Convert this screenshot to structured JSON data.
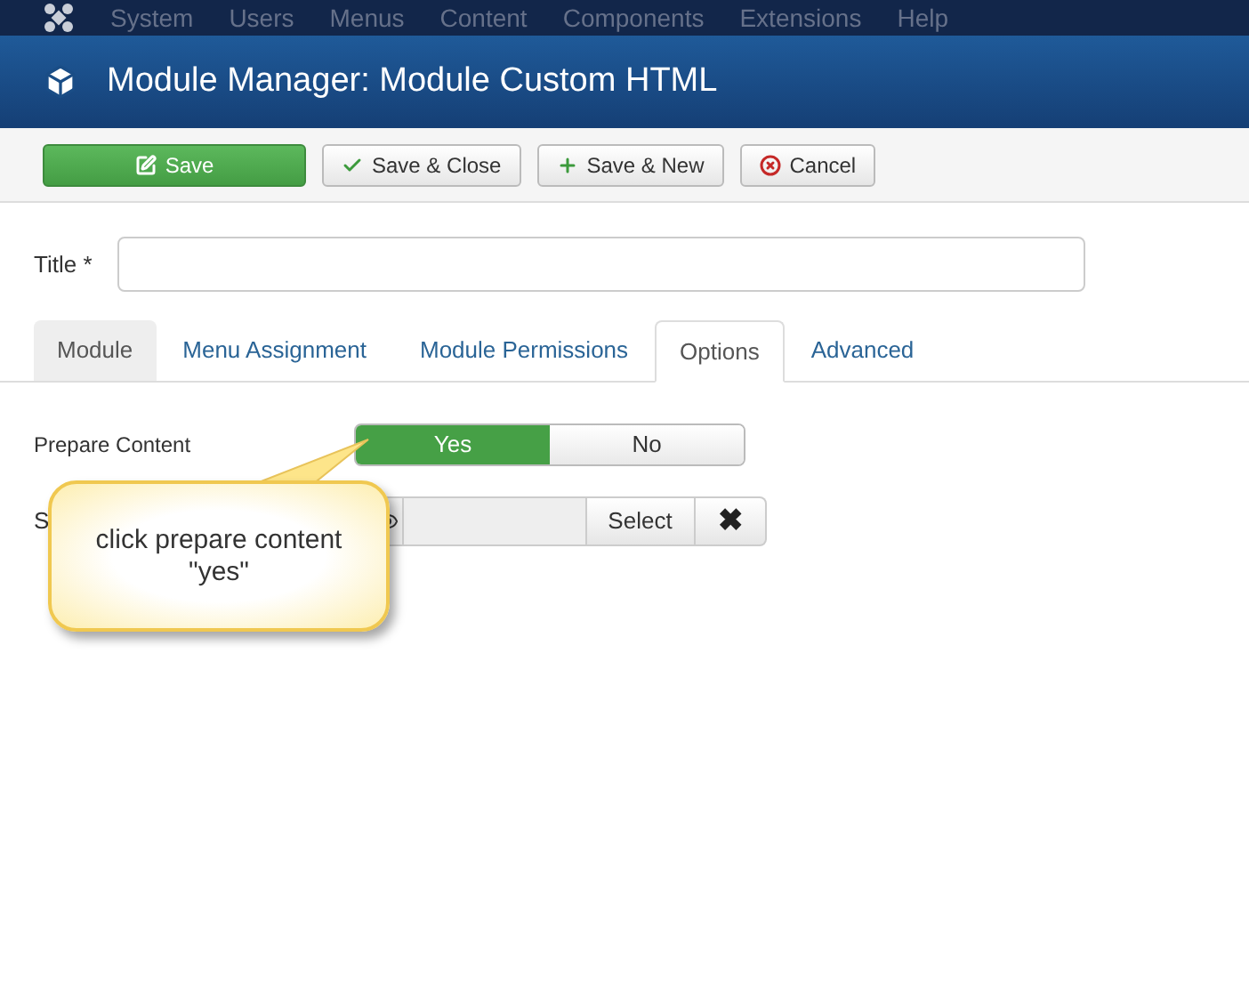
{
  "menu_bar": {
    "items": [
      "System",
      "Users",
      "Menus",
      "Content",
      "Components",
      "Extensions",
      "Help"
    ]
  },
  "header": {
    "title": "Module Manager: Module Custom HTML"
  },
  "toolbar": {
    "buttons": [
      {
        "kind": "primary",
        "label": "Save"
      },
      {
        "kind": "default",
        "label": "Save & Close"
      },
      {
        "kind": "default",
        "label": "Save & New"
      },
      {
        "kind": "default",
        "label": "Cancel"
      }
    ]
  },
  "title_field": {
    "label": "Title *"
  },
  "tabs": [
    {
      "label": "Module",
      "selected": false,
      "hovered": true
    },
    {
      "label": "Menu Assignment",
      "selected": false,
      "hovered": false
    },
    {
      "label": "Module Permissions",
      "selected": false,
      "hovered": false
    },
    {
      "label": "Options",
      "selected": true,
      "hovered": false
    },
    {
      "label": "Advanced",
      "selected": false,
      "hovered": false
    }
  ],
  "prepare_content": {
    "label": "Prepare Content",
    "options": [
      {
        "label": "Yes",
        "selected": true
      },
      {
        "label": "No",
        "selected": false
      }
    ]
  },
  "second_row": {
    "label": "S",
    "select_button": "Select",
    "clear_button": "✖"
  },
  "callout": {
    "text": "click prepare content \"yes\""
  }
}
